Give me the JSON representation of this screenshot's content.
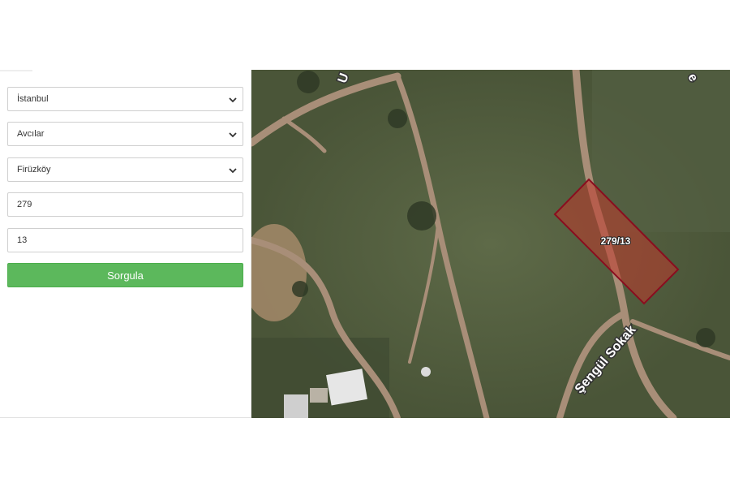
{
  "form": {
    "province": "İstanbul",
    "district": "Avcılar",
    "neighborhood": "Firüzköy",
    "block": "279",
    "parcel": "13",
    "query_button": "Sorgula"
  },
  "map": {
    "parcel_label": "279/13",
    "street_label": "Şengül Sokak",
    "top_left_fragment": "U",
    "top_right_fragment": "e",
    "parcel_fill": "#c0392b",
    "parcel_stroke": "#8b0d1f"
  },
  "icons": {
    "select_caret": "chevron-down-icon"
  }
}
